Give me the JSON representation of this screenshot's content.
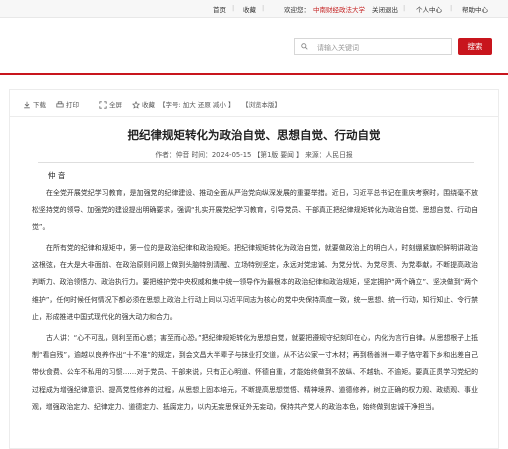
{
  "topbar": {
    "home": "首页",
    "favorite": "收藏",
    "greeting": "欢迎您：",
    "user": "中南财经政法大学",
    "logout": "关闭退出",
    "personal": "个人中心",
    "help": "帮助中心",
    "separator": "|"
  },
  "search": {
    "placeholder": "请输入关键词",
    "button": "搜索"
  },
  "toolbar": {
    "download": "下载",
    "print": "打印",
    "fullscreen": "全屏",
    "collect": "收藏",
    "font_size_label": "【字号: 加大 还原 减小 】",
    "browse_label": "【浏览本版】"
  },
  "article": {
    "title": "把纪律规矩转化为政治自觉、思想自觉、行动自觉",
    "meta": "作者：仲音  时间：2024-05-15 【第1版 要闻 】 来源：人民日报",
    "author": "仲 音",
    "paragraphs": [
      "在全党开展党纪学习教育，是加强党的纪律建设、推动全面从严治党向纵深发展的重要举措。近日，习近平总书记在重庆考察时，围绕毫不放松坚持党的领导、加强党的建设提出明确要求，强调“扎实开展党纪学习教育，引导党员、干部真正把纪律规矩转化为政治自觉、思想自觉、行动自觉”。",
      "在所有党的纪律和规矩中，第一位的是政治纪律和政治规矩。把纪律规矩转化为政治自觉，就要做政治上的明白人，时刻绷紧旗帜鲜明讲政治这根弦，在大是大非面前、在政治原则问题上做到头脑特别清醒、立场特别坚定，永远对党忠诚、为党分忧、为党尽责、为党奉献，不断提高政治判断力、政治领悟力、政治执行力。要把维护党中央权威和集中统一领导作为最根本的政治纪律和政治规矩，坚定拥护“两个确立”、坚决做到“两个维护”，任何时候任何情况下都必须在思想上政治上行动上同以习近平同志为核心的党中央保持高度一致，统一思想、统一行动，知行知止、令行禁止，形成推进中国式现代化的强大动力和合力。",
      "古人讲：“心不可乱，则利至而心惑；害至而心恐。”把纪律规矩转化为思想自觉，就要把遵规守纪刻印在心，内化为言行自律。从思想根子上抵制“看自残”，逾越以良养作出“十不准”的规定，到会文昌大半辈子与抹业打交道，从不沾公家一寸木材；再到杨善洲一辈子恪守着下乡和出差自己带伙食费、公车不私用的习惯……对于党员、干部来说，只有正心明道、怀德自重，才能始终做到不放纵、不越轨、不逾矩。要真正贯学习党纪的过程成为增强纪律意识、提高党性修养的过程，从思想上固本培元，不断提高思想觉悟、精神境界、道德修养，树立正确的权力观、政绩观、事业观，增强政治定力、纪律定力、道德定力、抵腐定力，以内无妄思保证外无妄动，保持共产党人的政治本色，始终做到忠诚干净担当。"
    ]
  }
}
